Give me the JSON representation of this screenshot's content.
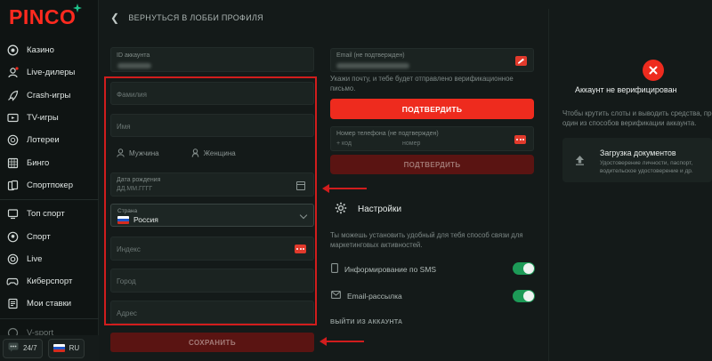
{
  "brand": {
    "logo_text": "PINCO",
    "accent": "#ee2b1e",
    "toggle_color": "#1d9a57"
  },
  "sidebar": {
    "items": [
      {
        "label": "Казино",
        "icon": "casino-chip-icon"
      },
      {
        "label": "Live-дилеры",
        "icon": "live-dealer-icon"
      },
      {
        "label": "Crash-игры",
        "icon": "rocket-icon"
      },
      {
        "label": "TV-игры",
        "icon": "tv-icon"
      },
      {
        "label": "Лотереи",
        "icon": "lottery-ball-icon"
      },
      {
        "label": "Бинго",
        "icon": "bingo-card-icon"
      },
      {
        "label": "Спортпокер",
        "icon": "poker-cards-icon"
      },
      {
        "label": "Топ спорт",
        "icon": "trophy-icon"
      },
      {
        "label": "Спорт",
        "icon": "sport-ball-icon"
      },
      {
        "label": "Live",
        "icon": "live-icon"
      },
      {
        "label": "Киберспорт",
        "icon": "gamepad-icon"
      },
      {
        "label": "Мои ставки",
        "icon": "bets-list-icon"
      },
      {
        "label": "V-sport",
        "icon": "vsport-icon"
      }
    ],
    "support_label": "24/7",
    "language_label": "RU"
  },
  "header": {
    "back_label": "ВЕРНУТЬСЯ В ЛОББИ ПРОФИЛЯ"
  },
  "profile_form": {
    "account_id_label": "ID аккаунта",
    "surname_placeholder": "Фамилия",
    "name_placeholder": "Имя",
    "gender_male": "Мужчина",
    "gender_female": "Женщина",
    "birthdate_label": "Дата рождения",
    "birthdate_placeholder": "ДД.ММ.ГГГГ",
    "country_label": "Страна",
    "country_value": "Россия",
    "index_placeholder": "Индекс",
    "city_placeholder": "Город",
    "address_placeholder": "Адрес",
    "save_label": "СОХРАНИТЬ"
  },
  "contact": {
    "email_label": "Email (не подтвержден)",
    "email_hint": "Укажи почту, и тебе будет отправлено верификационное письмо.",
    "confirm_email_label": "ПОДТВЕРДИТЬ",
    "phone_label": "Номер телефона (не подтвержден)",
    "phone_code_placeholder": "+ код",
    "phone_number_placeholder": "номер",
    "confirm_phone_label": "ПОДТВЕРДИТЬ"
  },
  "settings": {
    "title": "Настройки",
    "hint": "Ты можешь установить удобный для тебя способ связи для маркетинговых активностей.",
    "sms_label": "Информирование по SMS",
    "sms_on": true,
    "email_label": "Email-рассылка",
    "email_on": true,
    "logout_label": "ВЫЙТИ ИЗ АККАУНТА"
  },
  "verification": {
    "status_title": "Аккаунт не верифицирован",
    "status_text": "Чтобы крутить слоты и выводить средства, пройди один из способов верификации аккаунта.",
    "docs_title": "Загрузка документов",
    "docs_text": "Удостоверение личности, паспорт, водительское удостоверение и др."
  }
}
